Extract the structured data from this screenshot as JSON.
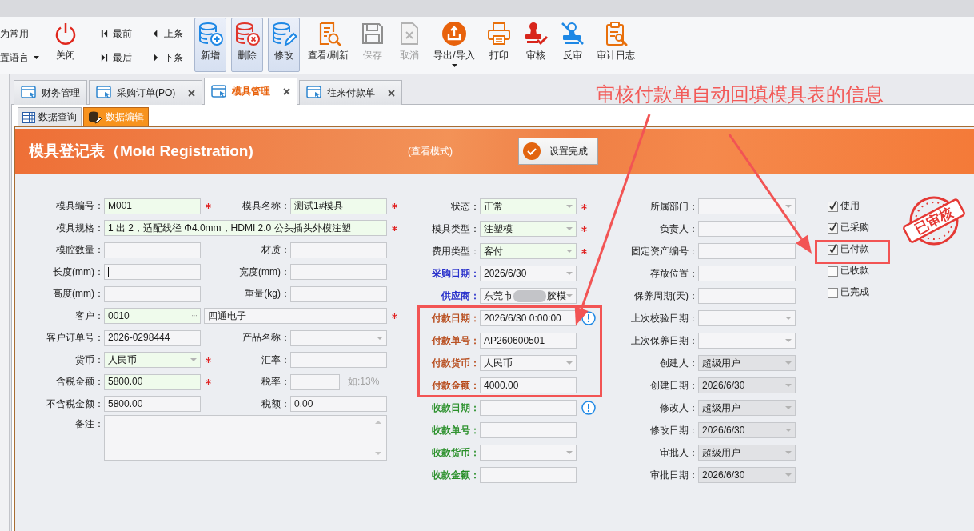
{
  "toolbar": {
    "quick_items": [
      {
        "label": "为常用",
        "dropdown": false
      },
      {
        "label": "置语言",
        "dropdown": true
      }
    ],
    "close_button": {
      "label": "关闭"
    },
    "navigation": [
      {
        "kind": "first",
        "label": "最前"
      },
      {
        "kind": "last",
        "label": "最后"
      },
      {
        "kind": "previous",
        "label": "上条"
      },
      {
        "kind": "next",
        "label": "下条"
      }
    ],
    "buttons": [
      {
        "kind": "add",
        "label": "新增",
        "highlighted": true,
        "disabled": false,
        "dropdown": false
      },
      {
        "kind": "delete",
        "label": "删除",
        "highlighted": true,
        "disabled": false,
        "dropdown": false
      },
      {
        "kind": "edit",
        "label": "修改",
        "highlighted": true,
        "disabled": false,
        "dropdown": false
      },
      {
        "kind": "view",
        "label": "查看/刷新",
        "highlighted": false,
        "disabled": false,
        "dropdown": false
      },
      {
        "kind": "save",
        "label": "保存",
        "highlighted": false,
        "disabled": true,
        "dropdown": false
      },
      {
        "kind": "cancel",
        "label": "取消",
        "highlighted": false,
        "disabled": true,
        "dropdown": false
      },
      {
        "kind": "export",
        "label": "导出/导入",
        "highlighted": false,
        "disabled": false,
        "dropdown": true
      },
      {
        "kind": "print",
        "label": "打印",
        "highlighted": false,
        "disabled": false,
        "dropdown": false
      },
      {
        "kind": "audit",
        "label": "审核",
        "highlighted": false,
        "disabled": false,
        "dropdown": false
      },
      {
        "kind": "unaudit",
        "label": "反审",
        "highlighted": false,
        "disabled": false,
        "dropdown": false
      },
      {
        "kind": "log",
        "label": "审计日志",
        "highlighted": false,
        "disabled": false,
        "dropdown": false
      }
    ]
  },
  "tabs": [
    {
      "label": "财务管理",
      "selected": false,
      "closable": false
    },
    {
      "label": "采购订单(PO)",
      "selected": false,
      "closable": true
    },
    {
      "label": "模具管理",
      "selected": true,
      "closable": true
    },
    {
      "label": "往来付款单",
      "selected": false,
      "closable": true
    }
  ],
  "annotation": {
    "text": "审核付款单自动回填模具表的信息"
  },
  "subtabs": [
    {
      "kind": "grid",
      "label": "数据查询",
      "selected": false
    },
    {
      "kind": "database",
      "label": "数据编辑",
      "selected": true
    }
  ],
  "header": {
    "title": "模具登记表（Mold Registration)",
    "mode": "(查看模式)",
    "done_button": "设置完成"
  },
  "form": {
    "left": [
      {
        "kind": "text",
        "label": "模具编号：",
        "value": "M001",
        "required": true
      },
      {
        "kind": "text",
        "label": "模具名称：",
        "value": "测试1#模具",
        "required": true
      },
      {
        "kind": "wide",
        "label": "模具规格：",
        "value": "1 出 2，适配线径 Φ4.0mm，HDMI 2.0 公头插头外模注塑",
        "required": true
      },
      {
        "kind": "text",
        "label": "模腔数量：",
        "required": false
      },
      {
        "kind": "text",
        "label": "材质：",
        "required": false
      },
      {
        "kind": "text",
        "label": "长度(mm)：",
        "required": false,
        "focused": true
      },
      {
        "kind": "text",
        "label": "宽度(mm)：",
        "required": false
      },
      {
        "kind": "text",
        "label": "高度(mm)：",
        "required": false
      },
      {
        "kind": "text",
        "label": "重量(kg)：",
        "required": false
      },
      {
        "kind": "lookup",
        "label": "客户：",
        "value": "0010",
        "lookup_button": "···",
        "name": "四通电子",
        "required": true
      },
      {
        "kind": "text",
        "label": "客户订单号：",
        "value": "2026-0298444",
        "required": false
      },
      {
        "kind": "combo",
        "label": "产品名称：",
        "required": false
      },
      {
        "kind": "combo",
        "label": "货币：",
        "value": "人民币",
        "required": true
      },
      {
        "kind": "text",
        "label": "汇率：",
        "required": false
      },
      {
        "kind": "text",
        "label": "含税金额：",
        "value": "5800.00",
        "required": true
      },
      {
        "kind": "rate",
        "label": "税率：",
        "hint": "如:13%",
        "required": false
      },
      {
        "kind": "text",
        "label": "不含税金额：",
        "value": "5800.00",
        "required": false
      },
      {
        "kind": "text",
        "label": "税额：",
        "value": "0.00",
        "required": false
      },
      {
        "kind": "memo",
        "label": "备注：",
        "required": false
      }
    ],
    "middle": [
      {
        "kind": "combo",
        "label": "状态：",
        "value": "正常",
        "required": true,
        "info": false
      },
      {
        "kind": "combo",
        "label": "模具类型：",
        "value": "注塑模",
        "required": true,
        "info": false
      },
      {
        "kind": "combo",
        "label": "费用类型：",
        "value": "客付",
        "required": true,
        "info": false
      },
      {
        "kind": "combo",
        "label": "采购日期：",
        "value": "2026/6/30",
        "color": "#1a22c8",
        "required": false,
        "info": false
      },
      {
        "kind": "combo",
        "label": "供应商：",
        "value": "东莞市",
        "value_after_blur": "胶模",
        "color": "#1a22c8",
        "required": false,
        "info": false
      },
      {
        "kind": "text",
        "label": "付款日期：",
        "value": "2026/6/30 0:00:00",
        "color": "#b4410e",
        "required": false,
        "info": true
      },
      {
        "kind": "text",
        "label": "付款单号：",
        "value": "AP260600501",
        "color": "#b4410e",
        "required": false,
        "info": false
      },
      {
        "kind": "combo",
        "label": "付款货币：",
        "value": "人民币",
        "color": "#b4410e",
        "required": false,
        "info": false
      },
      {
        "kind": "text",
        "label": "付款金额：",
        "value": "4000.00",
        "color": "#b4410e",
        "required": false,
        "info": false
      },
      {
        "kind": "text",
        "label": "收款日期：",
        "color": "#1e8a1e",
        "required": false,
        "info": true
      },
      {
        "kind": "text",
        "label": "收款单号：",
        "color": "#1e8a1e",
        "required": false,
        "info": false
      },
      {
        "kind": "combo",
        "label": "收款货币：",
        "color": "#1e8a1e",
        "required": false,
        "info": false
      },
      {
        "kind": "text",
        "label": "收款金额：",
        "color": "#1e8a1e",
        "required": false,
        "info": false
      }
    ],
    "right": [
      {
        "kind": "combo",
        "label": "所属部门：",
        "readonly": false
      },
      {
        "kind": "text",
        "label": "负责人：",
        "readonly": false
      },
      {
        "kind": "text",
        "label": "固定资产编号：",
        "readonly": false
      },
      {
        "kind": "text",
        "label": "存放位置：",
        "readonly": false
      },
      {
        "kind": "text",
        "label": "保养周期(天)：",
        "readonly": false
      },
      {
        "kind": "combo",
        "label": "上次校验日期：",
        "readonly": false
      },
      {
        "kind": "combo",
        "label": "上次保养日期：",
        "readonly": false
      },
      {
        "kind": "combo",
        "label": "创建人：",
        "value": "超级用户",
        "readonly": true
      },
      {
        "kind": "combo",
        "label": "创建日期：",
        "value": "2026/6/30",
        "readonly": true
      },
      {
        "kind": "combo",
        "label": "修改人：",
        "value": "超级用户",
        "readonly": true
      },
      {
        "kind": "combo",
        "label": "修改日期：",
        "value": "2026/6/30",
        "readonly": true
      },
      {
        "kind": "combo",
        "label": "审批人：",
        "value": "超级用户",
        "readonly": true
      },
      {
        "kind": "combo",
        "label": "审批日期：",
        "value": "2026/6/30",
        "readonly": true
      }
    ],
    "flags": [
      {
        "label": "使用",
        "checked": true
      },
      {
        "label": "已采购",
        "checked": true
      },
      {
        "label": "已付款",
        "checked": true
      },
      {
        "label": "已收款",
        "checked": false
      },
      {
        "label": "已完成",
        "checked": false
      }
    ]
  },
  "stamp": {
    "text": "已审核"
  }
}
